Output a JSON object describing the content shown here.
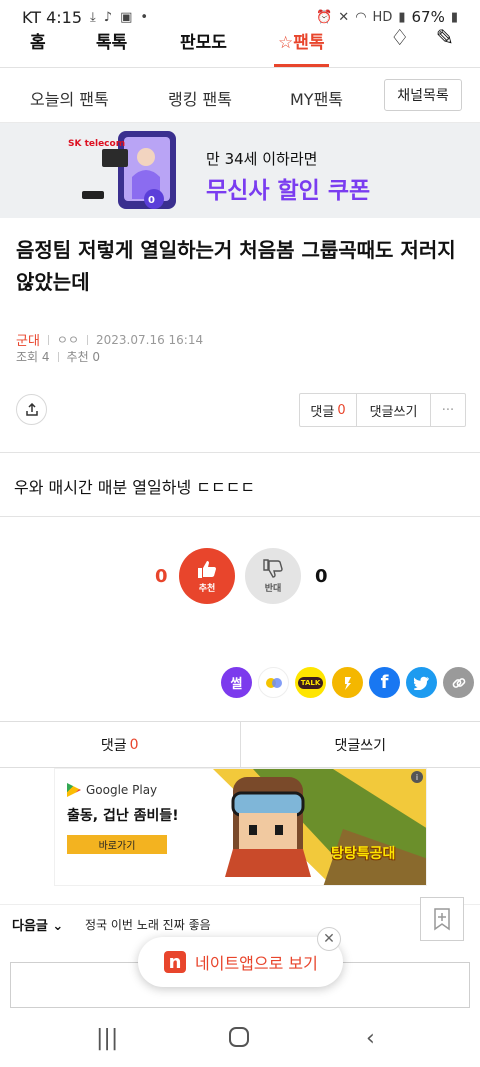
{
  "status_bar": {
    "carrier_time": "KT 4:15",
    "battery": "67%"
  },
  "top_nav": {
    "tabs": [
      {
        "label": "홈"
      },
      {
        "label": "톡톡"
      },
      {
        "label": "판모도"
      },
      {
        "label": "☆팬톡"
      }
    ]
  },
  "sub_nav": {
    "items": [
      "오늘의 팬톡",
      "랭킹 팬톡",
      "MY팬톡"
    ],
    "channel_button": "채널목록"
  },
  "banner": {
    "brand": "SK telecom",
    "line1": "만 34세 이하라면",
    "line2": "무신사 할인 쿠폰",
    "sticker": "0청년"
  },
  "post": {
    "title": "음정팀 저렇게 열일하는거 처음봄 그룹곡때도 저러지 않았는데",
    "category": "군대",
    "author": "ㅇㅇ",
    "datetime": "2023.07.16 16:14",
    "views": "조회 4",
    "recommends": "추천 0",
    "body": "우와 매시간 매분 열일하넹 ㄷㄷㄷㄷ"
  },
  "actions": {
    "comments_label": "댓글",
    "comments_count": "0",
    "write_comment": "댓글쓰기",
    "more": "···"
  },
  "votes": {
    "up_count": "0",
    "up_label": "추천",
    "down_count": "0",
    "down_label": "반대"
  },
  "share_icons": [
    {
      "name": "sseol",
      "label": "썰",
      "color": "#7c3aed"
    },
    {
      "name": "bubbles",
      "label": "",
      "color": "#ffffff"
    },
    {
      "name": "kakaotalk",
      "label": "TALK",
      "color": "#fee500"
    },
    {
      "name": "kakaostory",
      "label": "",
      "color": "#f4b700"
    },
    {
      "name": "facebook",
      "label": "f",
      "color": "#1877f2"
    },
    {
      "name": "twitter",
      "label": "",
      "color": "#1d9bf0"
    },
    {
      "name": "link",
      "label": "",
      "color": "#9a9a9a"
    }
  ],
  "comment_bar": {
    "comments_label": "댓글",
    "comments_count": "0",
    "write_comment": "댓글쓰기"
  },
  "ad": {
    "store": "Google Play",
    "headline": "출동, 겁난 좀비들!",
    "cta": "바로가기",
    "game_title": "탕탕특공대"
  },
  "next_post": {
    "label": "다음글",
    "title": "정국 이번 노래 진짜 좋음"
  },
  "toast": {
    "message": "네이트앱으로 보기"
  }
}
